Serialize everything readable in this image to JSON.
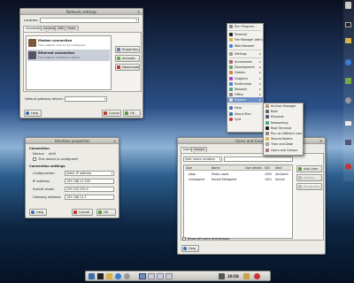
{
  "network_settings": {
    "title": "Network settings",
    "location_label": "Location:",
    "tabs": [
      "Connections",
      "General",
      "DNS",
      "Hosts"
    ],
    "connections": [
      {
        "name": "Modem connection",
        "desc": "This network card is not configured"
      },
      {
        "name": "Ethernet connection",
        "desc": "This network interface is active"
      }
    ],
    "side_buttons": [
      "Properties",
      "Activate",
      "Deactivate"
    ],
    "gateway_label": "Default gateway device:",
    "help": "Help",
    "cancel": "Cancel",
    "ok": "OK"
  },
  "interface_props": {
    "title": "Interface properties",
    "section1": "Connection",
    "device_label": "Device:",
    "device_value": "eth0",
    "enable_label": "This device is configured",
    "section2": "Connection settings",
    "fields": [
      {
        "label": "Configuration:",
        "value": "Static IP address"
      },
      {
        "label": "IP address:",
        "value": "192.168.11.200"
      },
      {
        "label": "Subnet mask:",
        "value": "255.255.255.0"
      },
      {
        "label": "Gateway address:",
        "value": "192.168.11.1"
      }
    ],
    "help": "Help",
    "cancel": "Cancel",
    "ok": "OK"
  },
  "users_groups": {
    "title": "Users and Groups",
    "tabs": [
      "Users",
      "Groups"
    ],
    "filter_value": "User name contains",
    "columns": [
      "User",
      "Name",
      "User details",
      "UID",
      "Shell"
    ],
    "rows": [
      {
        "user": "pdap",
        "name": "Pedro Lopez",
        "uid": "1000",
        "shell": "/bin/bash"
      },
      {
        "user": "rmidagallet",
        "name": "Ronald Midagallet",
        "uid": "1001",
        "shell": "/bin/sh"
      }
    ],
    "side_buttons": [
      "Add User",
      "Delete",
      "Properties"
    ],
    "show_all": "Show all users and groups",
    "help": "Help"
  },
  "main_menu": {
    "items": [
      "Run Program...",
      "Terminal",
      "File Manager (efm)",
      "Web Browser",
      "Settings",
      "Accessories",
      "Development",
      "Games",
      "Graphics",
      "Multimedia",
      "Network",
      "Office",
      "System",
      "Help",
      "About Xfce",
      "Quit"
    ],
    "submenu_items": [
      "Archive Manager",
      "Boot",
      "Ethernet",
      "Networking",
      "Root Terminal",
      "Run as different user",
      "Shared folders",
      "Time and Date",
      "Users and Groups"
    ]
  },
  "taskbar": {
    "clock": "20:58"
  }
}
